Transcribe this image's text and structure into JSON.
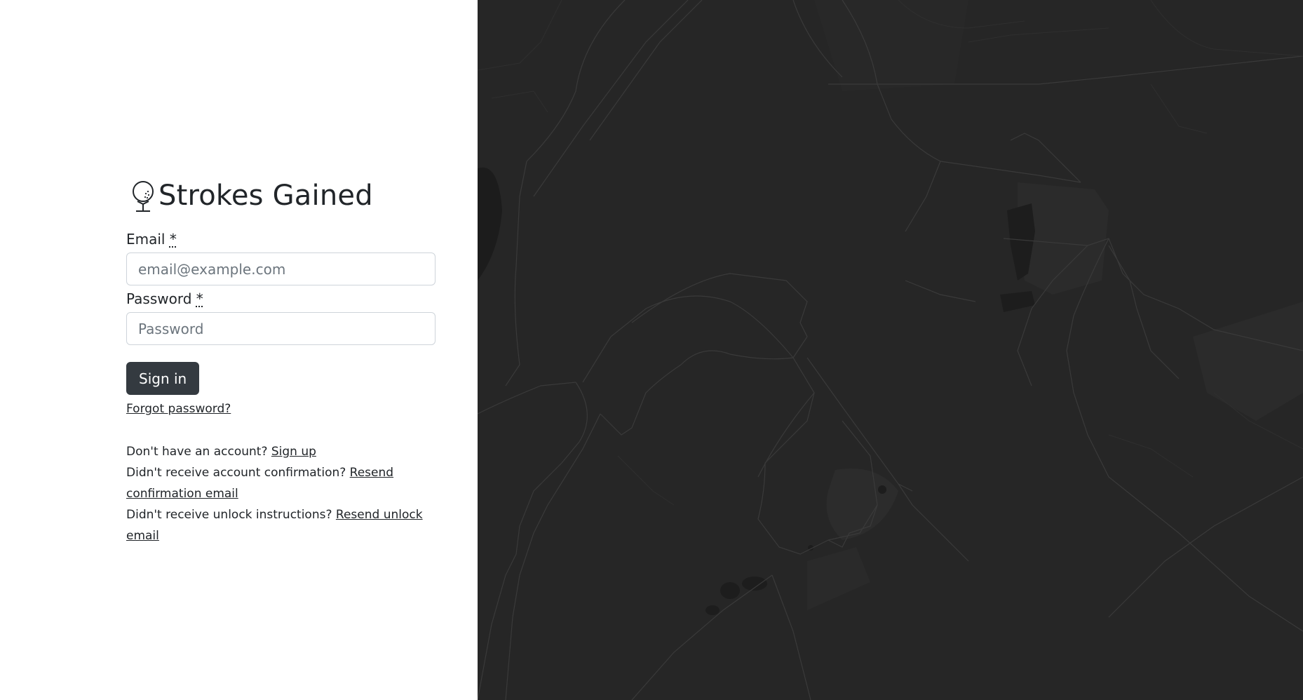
{
  "brand": {
    "title": "Strokes Gained",
    "icon": "golf-ball-on-tee-icon"
  },
  "form": {
    "email": {
      "label": "Email",
      "required_marker": "*",
      "placeholder": "email@example.com",
      "value": ""
    },
    "password": {
      "label": "Password",
      "required_marker": "*",
      "placeholder": "Password",
      "value": ""
    },
    "submit_label": "Sign in",
    "forgot_label": "Forgot password?"
  },
  "links": {
    "signup_prompt": "Don't have an account?",
    "signup_link": "Sign up",
    "confirm_prompt": "Didn't receive account confirmation?",
    "confirm_link": "Resend confirmation email",
    "unlock_prompt": "Didn't receive unlock instructions?",
    "unlock_link": "Resend unlock email"
  },
  "colors": {
    "map_background": "#262626",
    "button_background": "#343a40",
    "text": "#212529"
  }
}
